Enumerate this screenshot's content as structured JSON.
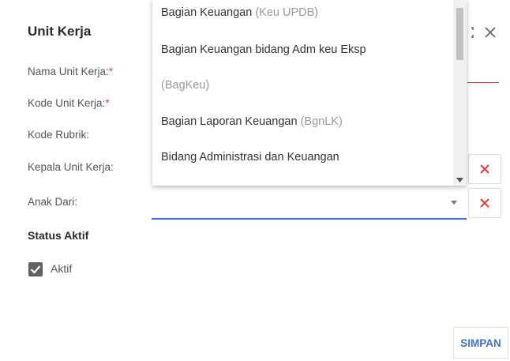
{
  "dialog": {
    "title": "Unit Kerja",
    "fields": {
      "nama_label": "Nama Unit Kerja:",
      "kode_label": "Kode Unit Kerja:",
      "required_mark": "*",
      "rubrik_label": "Kode Rubrik:",
      "kepala_label": "Kepala Unit Kerja:",
      "anak_label": "Anak Dari:"
    },
    "status_heading": "Status Aktif",
    "checkbox": {
      "label": "Aktif",
      "checked": true
    },
    "save_label": "SIMPAN"
  },
  "dropdown": {
    "options": [
      {
        "label": "Bagian Keuangan",
        "abbr": "(Keu UPDB)"
      },
      {
        "label": "Bagian Keuangan bidang Adm keu Eksp",
        "abbr": ""
      },
      {
        "label": "",
        "abbr": "(BagKeu)"
      },
      {
        "label": "Bagian Laporan Keuangan",
        "abbr": "(BgnLK)"
      },
      {
        "label": "Bidang Administrasi dan Keuangan",
        "abbr": ""
      }
    ]
  },
  "colors": {
    "accent": "#3f6fd8",
    "required": "#e53935",
    "clear_x": "#e53935"
  },
  "icons": [
    "expand-icon",
    "close-icon",
    "clear-icon",
    "dropdown-arrow-icon",
    "check-icon"
  ]
}
